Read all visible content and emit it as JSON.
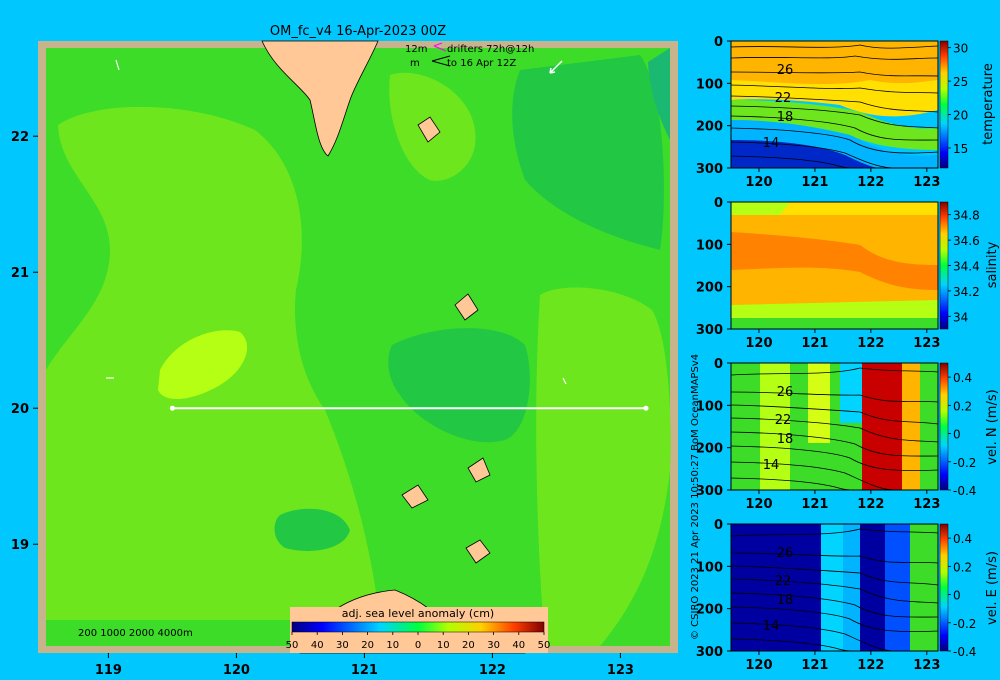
{
  "title": "OM_fc_v4  16-Apr-2023 00Z",
  "legend": {
    "arrow_speed": "12m",
    "arrow_unit": "m",
    "drifters": "drifters 72h@12h",
    "drifters_to": "to 16 Apr 12Z",
    "colors": {
      "drifter": "#ff00ff"
    }
  },
  "depth_legend": "200  1000  2000  4000m",
  "copyright": "© CSIRO 2023   21 Apr 2023 10:50:27 BoM OceanMAPSv4",
  "colors": {
    "background": "#00c8ff",
    "frame": "#c8b48c",
    "land": "#ffc896",
    "section_line": "#ffffff"
  },
  "chart_data": [
    {
      "type": "heatmap",
      "name": "map",
      "title": "OM_fc_v4  16-Apr-2023 00Z",
      "x_ticks": [
        "119",
        "120",
        "121",
        "122",
        "123"
      ],
      "y_ticks": [
        "19",
        "20",
        "21",
        "22"
      ],
      "xlim": [
        118.45,
        123.45
      ],
      "ylim": [
        18.2,
        22.7
      ],
      "colorbar": {
        "label": "adj. sea level anomaly (cm)",
        "ticks": [
          "-50",
          "-40",
          "-30",
          "-20",
          "-10",
          "0",
          "10",
          "20",
          "30",
          "40",
          "50"
        ],
        "range": [
          -50,
          50
        ]
      },
      "section": {
        "lon": [
          119.5,
          123.2
        ],
        "lat": [
          20,
          20
        ]
      }
    },
    {
      "type": "heatmap",
      "name": "temperature",
      "x_ticks": [
        "120",
        "121",
        "122",
        "123"
      ],
      "y_ticks": [
        "0",
        "100",
        "200",
        "300"
      ],
      "xlim": [
        119.5,
        123.2
      ],
      "ylim": [
        300,
        0
      ],
      "contour_labels": [
        "26",
        "22",
        "18",
        "14"
      ],
      "colorbar": {
        "label": "temperature",
        "ticks": [
          "15",
          "20",
          "25",
          "30"
        ],
        "range": [
          12,
          31
        ]
      }
    },
    {
      "type": "heatmap",
      "name": "salinity",
      "x_ticks": [
        "120",
        "121",
        "122",
        "123"
      ],
      "y_ticks": [
        "0",
        "100",
        "200",
        "300"
      ],
      "xlim": [
        119.5,
        123.2
      ],
      "ylim": [
        300,
        0
      ],
      "colorbar": {
        "label": "salinity",
        "ticks": [
          "34",
          "34.2",
          "34.4",
          "34.6",
          "34.8"
        ],
        "range": [
          33.9,
          34.9
        ]
      }
    },
    {
      "type": "heatmap",
      "name": "vel_n",
      "x_ticks": [
        "120",
        "121",
        "122",
        "123"
      ],
      "y_ticks": [
        "0",
        "100",
        "200",
        "300"
      ],
      "xlim": [
        119.5,
        123.2
      ],
      "ylim": [
        300,
        0
      ],
      "contour_labels": [
        "26",
        "22",
        "18",
        "14"
      ],
      "colorbar": {
        "label": "vel. N (m/s)",
        "ticks": [
          "-0.4",
          "-0.2",
          "0",
          "0.2",
          "0.4"
        ],
        "range": [
          -0.4,
          0.5
        ]
      }
    },
    {
      "type": "heatmap",
      "name": "vel_e",
      "x_ticks": [
        "120",
        "121",
        "122",
        "123"
      ],
      "y_ticks": [
        "0",
        "100",
        "200",
        "300"
      ],
      "xlim": [
        119.5,
        123.2
      ],
      "ylim": [
        300,
        0
      ],
      "contour_labels": [
        "26",
        "22",
        "18",
        "14"
      ],
      "colorbar": {
        "label": "vel. E (m/s)",
        "ticks": [
          "-0.4",
          "-0.2",
          "0",
          "0.2",
          "0.4"
        ],
        "range": [
          -0.4,
          0.5
        ]
      }
    }
  ]
}
